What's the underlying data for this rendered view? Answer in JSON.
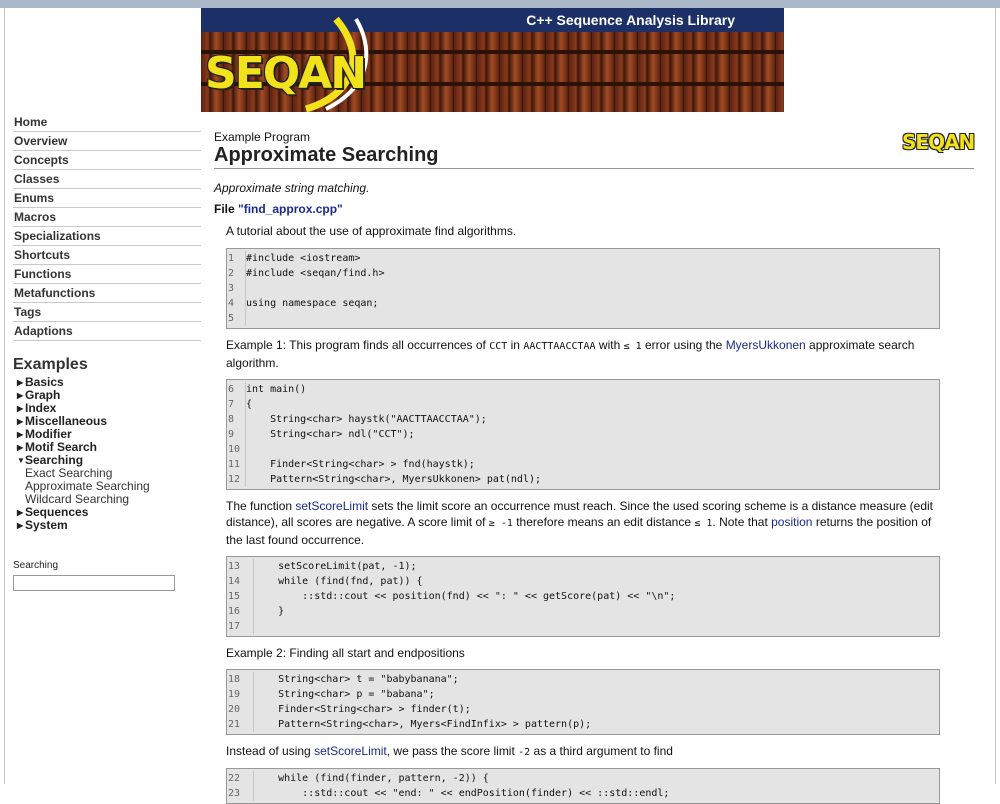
{
  "banner": {
    "title": "C++ Sequence Analysis Library",
    "logo": "SEQAN"
  },
  "sidebar": {
    "nav": [
      "Home",
      "Overview",
      "Concepts",
      "Classes",
      "Enums",
      "Macros",
      "Specializations",
      "Shortcuts",
      "Functions",
      "Metafunctions",
      "Tags",
      "Adaptions"
    ],
    "examples_title": "Examples",
    "examples": [
      {
        "label": "Basics",
        "state": "collapsed"
      },
      {
        "label": "Graph",
        "state": "collapsed"
      },
      {
        "label": "Index",
        "state": "collapsed"
      },
      {
        "label": "Miscellaneous",
        "state": "collapsed"
      },
      {
        "label": "Modifier",
        "state": "collapsed"
      },
      {
        "label": "Motif Search",
        "state": "collapsed"
      },
      {
        "label": "Searching",
        "state": "expanded"
      }
    ],
    "searching_children": [
      "Exact Searching",
      "Approximate Searching",
      "Wildcard Searching"
    ],
    "examples_after": [
      {
        "label": "Sequences",
        "state": "collapsed"
      },
      {
        "label": "System",
        "state": "collapsed"
      }
    ],
    "search_label": "Searching",
    "search_value": ""
  },
  "main": {
    "kicker": "Example Program",
    "title": "Approximate Searching",
    "logo": "SEQAN",
    "summary": "Approximate string matching.",
    "file_prefix": "File",
    "file_link": "\"find_approx.cpp\"",
    "intro": "A tutorial about the use of approximate find algorithms.",
    "code1": [
      {
        "n": "1",
        "t": "#include <iostream>"
      },
      {
        "n": "2",
        "t": "#include <seqan/find.h>"
      },
      {
        "n": "3",
        "t": ""
      },
      {
        "n": "4",
        "t": "using namespace seqan;"
      },
      {
        "n": "5",
        "t": ""
      }
    ],
    "p1": {
      "a": "Example 1: This program finds all occurrences of ",
      "code_a": "CCT",
      "b": " in ",
      "code_b": "AACTTAACCTAA",
      "c": " with ",
      "code_c": "≤ 1",
      "d": " error using the ",
      "link": "MyersUkkonen",
      "e": " approximate search algorithm."
    },
    "code2": [
      {
        "n": "6",
        "t": "int main()"
      },
      {
        "n": "7",
        "t": "{"
      },
      {
        "n": "8",
        "t": "    String<char> haystk(\"AACTTAACCTAA\");"
      },
      {
        "n": "9",
        "t": "    String<char> ndl(\"CCT\");"
      },
      {
        "n": "10",
        "t": ""
      },
      {
        "n": "11",
        "t": "    Finder<String<char> > fnd(haystk);"
      },
      {
        "n": "12",
        "t": "    Pattern<String<char>, MyersUkkonen> pat(ndl);"
      }
    ],
    "p2": {
      "a": "The function ",
      "link1": "setScoreLimit",
      "b": " sets the limit score an occurrence must reach. Since the used scoring scheme is a distance measure (edit distance), all scores are negative. A score limit of ",
      "code_a": "≥ -1",
      "c": " therefore means an edit distance ",
      "code_b": "≤ 1",
      "d": ". Note that ",
      "link2": "position",
      "e": " returns the position of the last found occurrence."
    },
    "code3": [
      {
        "n": "13",
        "t": "    setScoreLimit(pat, -1);"
      },
      {
        "n": "14",
        "t": "    while (find(fnd, pat)) {"
      },
      {
        "n": "15",
        "t": "        ::std::cout << position(fnd) << \": \" << getScore(pat) << \"\\n\";"
      },
      {
        "n": "16",
        "t": "    }"
      },
      {
        "n": "17",
        "t": ""
      }
    ],
    "p3": "Example 2: Finding all start and endpositions",
    "code4": [
      {
        "n": "18",
        "t": "    String<char> t = \"babybanana\";"
      },
      {
        "n": "19",
        "t": "    String<char> p = \"babana\";"
      },
      {
        "n": "20",
        "t": "    Finder<String<char> > finder(t);"
      },
      {
        "n": "21",
        "t": "    Pattern<String<char>, Myers<FindInfix> > pattern(p);"
      }
    ],
    "p4": {
      "a": "Instead of using ",
      "link": "setScoreLimit",
      "b": ", we pass the score limit ",
      "code": "-2",
      "c": " as a third argument to find"
    },
    "code5": [
      {
        "n": "22",
        "t": "    while (find(finder, pattern, -2)) {"
      },
      {
        "n": "23",
        "t": "        ::std::cout << \"end: \" << endPosition(finder) << ::std::endl;"
      }
    ]
  }
}
